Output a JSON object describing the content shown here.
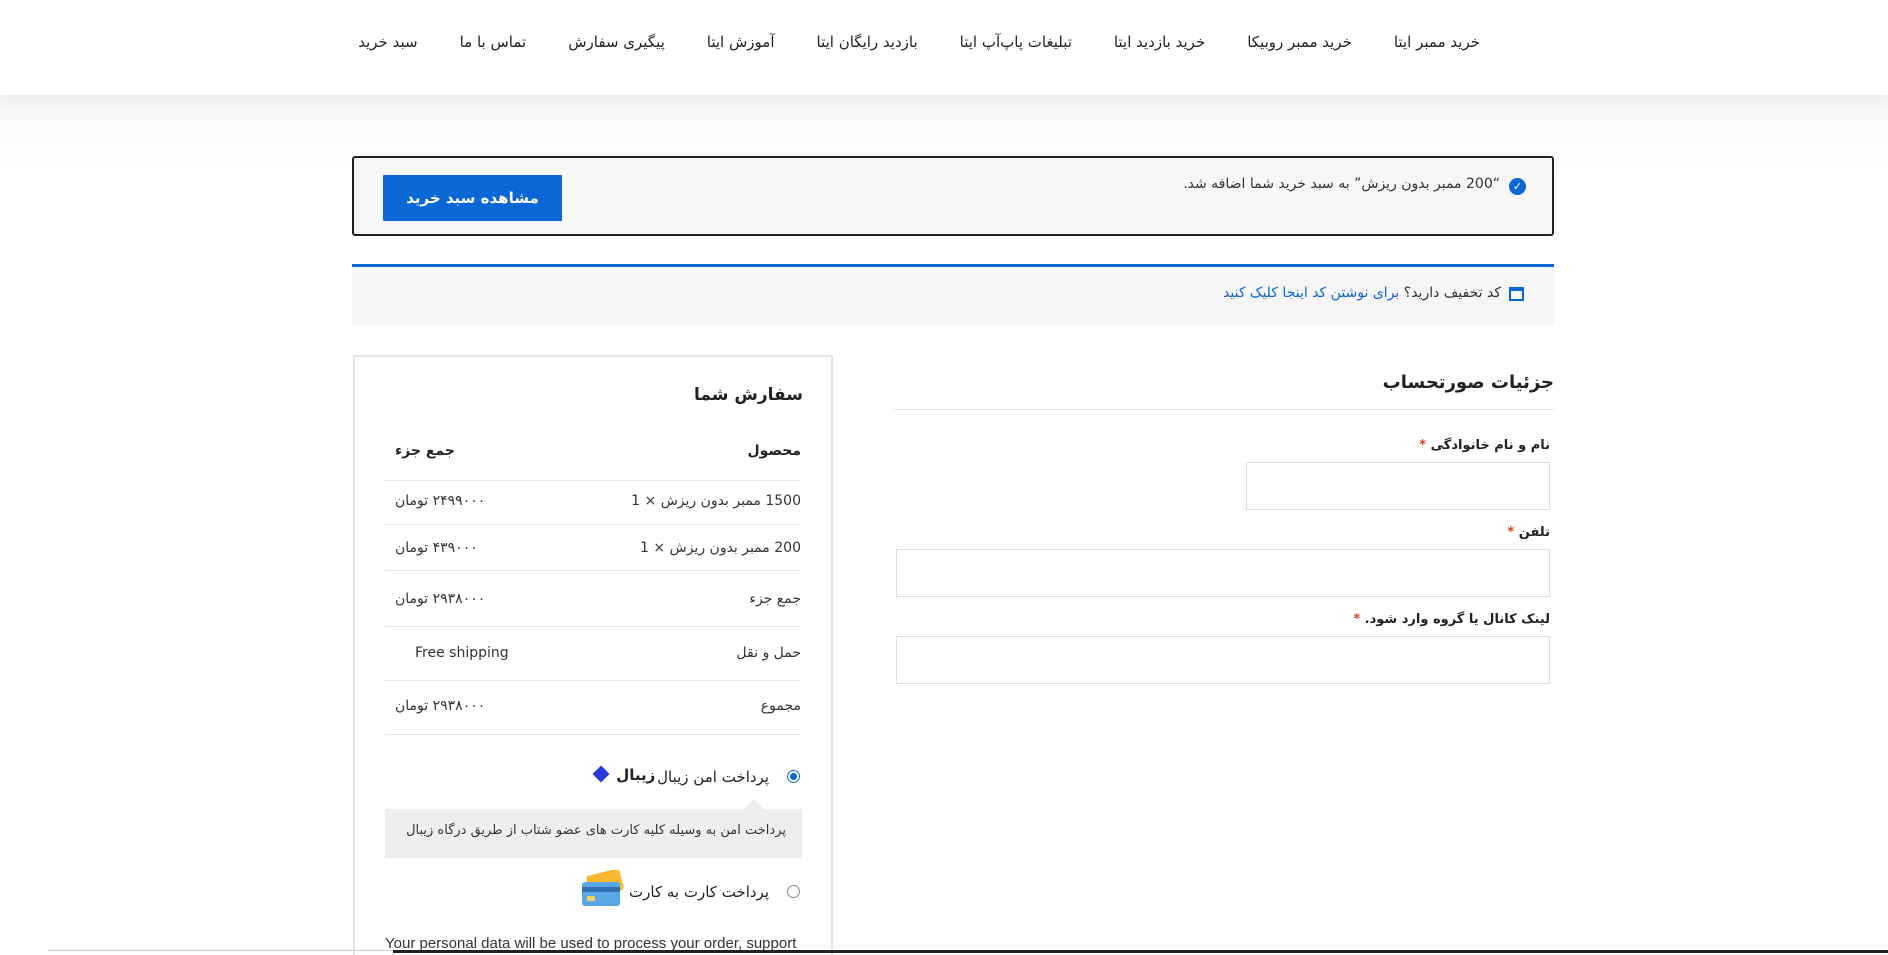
{
  "nav": {
    "items": [
      {
        "label": "خرید ممبر ایتا"
      },
      {
        "label": "خرید ممبر روبیکا"
      },
      {
        "label": "خرید بازدید ایتا"
      },
      {
        "label": "تبلیغات پاپ‌آپ ایتا"
      },
      {
        "label": "بازدید رایگان ایتا"
      },
      {
        "label": "آموزش ایتا"
      },
      {
        "label": "پیگیری سفارش"
      },
      {
        "label": "تماس با ما"
      },
      {
        "label": "سبد خرید"
      }
    ]
  },
  "notice": {
    "icon": "check-circle-icon",
    "message": "“200 ممبر بدون ریزش” به سبد خرید شما اضافه شد.",
    "button_label": "مشاهده سبد خرید"
  },
  "coupon": {
    "icon": "calendar-icon",
    "prompt": "کد تخفیف دارید؟",
    "link": "برای نوشتن کد اینجا کلیک کنید"
  },
  "billing": {
    "title": "جزئیات صورتحساب",
    "fields": [
      {
        "label": "نام و نام خانوادگی",
        "required": "*",
        "value": ""
      },
      {
        "label": "تلفن",
        "required": "*",
        "value": ""
      },
      {
        "label": "لینک کانال یا گروه وارد شود.",
        "required": "*",
        "value": ""
      }
    ]
  },
  "order": {
    "title": "سفارش شما",
    "col_product": "محصول",
    "col_subtotal": "جمع جزء",
    "items": [
      {
        "name": "1500 ممبر بدون ریزش",
        "qty": "× 1",
        "price": "۲۴۹۹۰۰۰ تومان"
      },
      {
        "name": "200 ممبر بدون ریزش",
        "qty": "× 1",
        "price": "۴۳۹۰۰۰ تومان"
      }
    ],
    "subtotal_label": "جمع جزء",
    "subtotal_value": "۲۹۳۸۰۰۰ تومان",
    "shipping_label": "حمل و نقل",
    "shipping_value": "Free shipping",
    "total_label": "مجموع",
    "total_value": "۲۹۳۸۰۰۰ تومان"
  },
  "payment": {
    "methods": [
      {
        "label": "پرداخت امن زیبال",
        "logo_text": "زیبال",
        "selected": true,
        "description": "پرداخت امن به وسیله کلیه کارت های عضو شتاب از طریق درگاه زیبال"
      },
      {
        "label": "پرداخت کارت به کارت",
        "selected": false
      }
    ],
    "privacy_text": "Your personal data will be used to process your order, support"
  },
  "colors": {
    "accent": "#0b66d6",
    "required": "#e2401c"
  }
}
